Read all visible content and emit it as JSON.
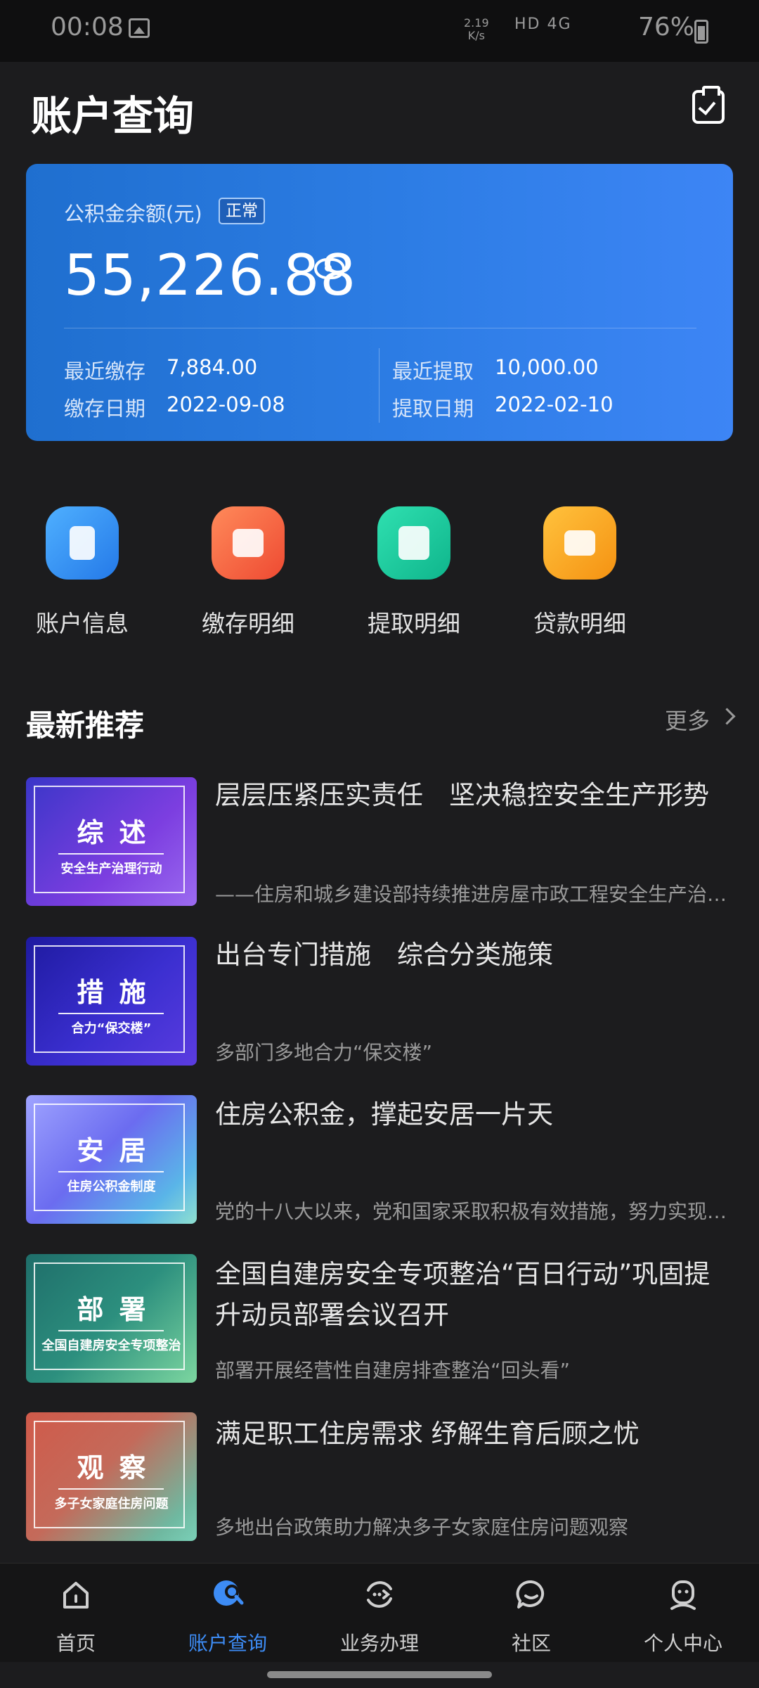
{
  "status_bar": {
    "time": "00:08",
    "net_speed_value": "2.19",
    "net_speed_unit": "K/s",
    "indicators": "HD 4G",
    "battery": "76%"
  },
  "header": {
    "title": "账户查询"
  },
  "balance_card": {
    "label": "公积金余额(元)",
    "status_badge": "正常",
    "amount": "55,226.88",
    "recent_deposit_label": "最近缴存",
    "recent_deposit_value": "7,884.00",
    "deposit_date_label": "缴存日期",
    "deposit_date_value": "2022-09-08",
    "recent_withdraw_label": "最近提取",
    "recent_withdraw_value": "10,000.00",
    "withdraw_date_label": "提取日期",
    "withdraw_date_value": "2022-02-10"
  },
  "quick_actions": [
    {
      "label": "账户信息",
      "icon": "phone-search-icon",
      "color": "#2f8ff0"
    },
    {
      "label": "缴存明细",
      "icon": "wallet-icon",
      "color": "#f2603c"
    },
    {
      "label": "提取明细",
      "icon": "yuan-card-icon",
      "color": "#13c49a"
    },
    {
      "label": "贷款明细",
      "icon": "card-icon",
      "color": "#f7a21b"
    }
  ],
  "recommend": {
    "title": "最新推荐",
    "more": "更多",
    "items": [
      {
        "thumb_title": "综述",
        "thumb_sub": "安全生产治理行动",
        "title": "层层压紧压实责任　坚决稳控安全生产形势",
        "subtitle": "——住房和城乡建设部持续推进房屋市政工程安全生产治理行动"
      },
      {
        "thumb_title": "措施",
        "thumb_sub": "合力“保交楼”",
        "title": "出台专门措施　综合分类施策",
        "subtitle": "多部门多地合力“保交楼”"
      },
      {
        "thumb_title": "安居",
        "thumb_sub": "住房公积金制度",
        "title": "住房公积金，撑起安居一片天",
        "subtitle": "党的十八大以来，党和国家采取积极有效措施，努力实现全体人民住有所居"
      },
      {
        "thumb_title": "部署",
        "thumb_sub": "全国自建房安全专项整治",
        "title": "全国自建房安全专项整治“百日行动”巩固提升动员部署会议召开",
        "subtitle": "部署开展经营性自建房排查整治“回头看”"
      },
      {
        "thumb_title": "观察",
        "thumb_sub": "多子女家庭住房问题",
        "title": "满足职工住房需求 纾解生育后顾之忧",
        "subtitle": "多地出台政策助力解决多子女家庭住房问题观察"
      }
    ]
  },
  "bottom_nav": [
    {
      "label": "首页",
      "icon": "home-icon"
    },
    {
      "label": "账户查询",
      "icon": "account-search-icon"
    },
    {
      "label": "业务办理",
      "icon": "business-icon"
    },
    {
      "label": "社区",
      "icon": "chat-icon"
    },
    {
      "label": "个人中心",
      "icon": "profile-icon"
    }
  ],
  "colors": {
    "accent": "#3d8cf5",
    "background": "#1c1c1e"
  }
}
